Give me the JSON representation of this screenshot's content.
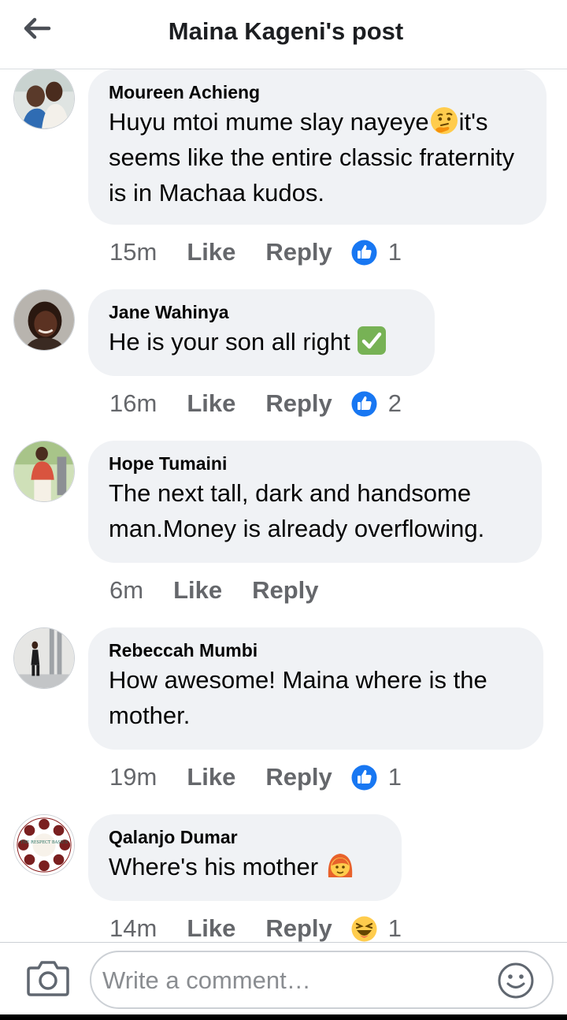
{
  "header": {
    "title": "Maina Kageni's post",
    "back_icon": "arrow-left-icon"
  },
  "colors": {
    "bubble": "#f0f2f5",
    "meta_text": "#65676b",
    "like_blue": "#1877f2",
    "emoji_yellow": "#ffcc4d"
  },
  "comments": [
    {
      "author": "Moureen Achieng",
      "text_part1": "Huyu mtoi mume slay nayeye",
      "emoji": "thinking-face-icon",
      "text_part2": "it's seems like the entire classic fraternity is in Machaa kudos.",
      "time": "15m",
      "like_label": "Like",
      "reply_label": "Reply",
      "reaction": "like-reaction-icon",
      "reaction_count": "1"
    },
    {
      "author": "Jane Wahinya",
      "text_part1": "He is your son all right",
      "emoji": "check-mark-icon",
      "time": "16m",
      "like_label": "Like",
      "reply_label": "Reply",
      "reaction": "like-reaction-icon",
      "reaction_count": "2"
    },
    {
      "author": "Hope Tumaini",
      "text_part1": "The next tall, dark and handsome man.Money is already overflowing.",
      "time": "6m",
      "like_label": "Like",
      "reply_label": "Reply"
    },
    {
      "author": "Rebeccah Mumbi",
      "text_part1": "How awesome! Maina where is the mother.",
      "time": "19m",
      "like_label": "Like",
      "reply_label": "Reply",
      "reaction": "like-reaction-icon",
      "reaction_count": "1"
    },
    {
      "author": "Qalanjo Dumar",
      "text_part1": "Where's his mother",
      "emoji": "woman-face-icon",
      "time": "14m",
      "like_label": "Like",
      "reply_label": "Reply",
      "reaction": "haha-reaction-icon",
      "reaction_count": "1"
    }
  ],
  "avatar4_logo_text": "THE RESPECT BASICS",
  "composer": {
    "placeholder": "Write a comment…",
    "value": "",
    "camera_icon": "camera-icon",
    "emoji_icon": "smiley-icon"
  }
}
